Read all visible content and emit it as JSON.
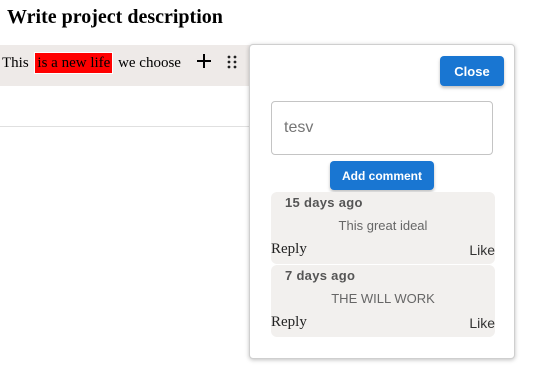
{
  "page": {
    "title": "Write project description"
  },
  "editor": {
    "text_before": "This",
    "highlighted_text": "is a new life",
    "text_after": "we choose",
    "highlight_color": "#ff0000",
    "add_icon": "plus-icon",
    "drag_icon": "drag-handle-icon"
  },
  "comment_panel": {
    "close_label": "Close",
    "input_value": "tesv",
    "add_comment_label": "Add comment",
    "accent_color": "#1976d2",
    "comments": [
      {
        "time": "15 days ago",
        "text": "This great ideal",
        "reply_label": "Reply",
        "like_label": "Like"
      },
      {
        "time": "7 days ago",
        "text": "THE WILL WORK",
        "reply_label": "Reply",
        "like_label": "Like"
      }
    ]
  }
}
